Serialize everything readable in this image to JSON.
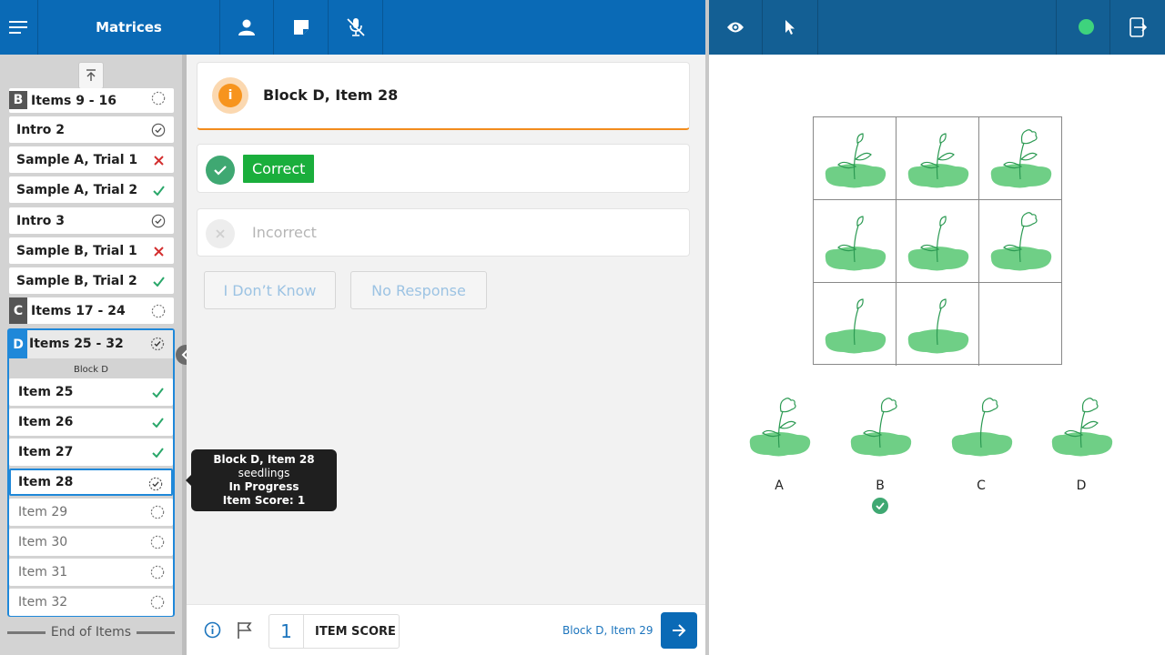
{
  "app": {
    "title": "Matrices"
  },
  "sidebar": {
    "rows": [
      {
        "label": "Items 9 - 16",
        "badge": "B",
        "badge_color": "#555555",
        "status": "pending"
      },
      {
        "label": "Intro 2",
        "status": "done"
      },
      {
        "label": "Sample A, Trial 1",
        "status": "incorrect"
      },
      {
        "label": "Sample A, Trial 2",
        "status": "correct"
      },
      {
        "label": "Intro 3",
        "status": "done"
      },
      {
        "label": "Sample B, Trial 1",
        "status": "incorrect"
      },
      {
        "label": "Sample B, Trial 2",
        "status": "correct"
      },
      {
        "label": "Items 17 - 24",
        "badge": "C",
        "badge_color": "#555555",
        "status": "pending"
      }
    ],
    "block_d": {
      "header": "Items 25 - 32",
      "badge": "D",
      "badge_color": "#1f88d9",
      "sub_label": "Block D",
      "items": [
        {
          "label": "Item 25",
          "status": "correct"
        },
        {
          "label": "Item 26",
          "status": "correct"
        },
        {
          "label": "Item 27",
          "status": "correct"
        },
        {
          "label": "Item 28",
          "status": "in-progress"
        },
        {
          "label": "Item 29",
          "status": "pending"
        },
        {
          "label": "Item 30",
          "status": "pending"
        },
        {
          "label": "Item 31",
          "status": "pending"
        },
        {
          "label": "Item 32",
          "status": "pending"
        }
      ]
    },
    "end_label": "End of Items"
  },
  "main": {
    "item_title": "Block D, Item 28",
    "correct_label": "Correct",
    "incorrect_label": "Incorrect",
    "dont_know_label": "I Don’t Know",
    "no_response_label": "No Response"
  },
  "tooltip": {
    "line1": "Block D, Item 28",
    "line2": "seedlings",
    "line3": "In Progress",
    "line4": "Item Score: 1"
  },
  "footer": {
    "score_value": "1",
    "score_label": "ITEM SCORE",
    "next_item_link": "Block D, Item 29"
  },
  "stimulus": {
    "options": [
      "A",
      "B",
      "C",
      "D"
    ],
    "selected_option": "B"
  },
  "colors": {
    "header_blue": "#0a6ab6",
    "header_dark": "#135f94",
    "correct_green": "#1aae3c",
    "warning_orange": "#f7941d",
    "status_online": "#3ed37d"
  }
}
